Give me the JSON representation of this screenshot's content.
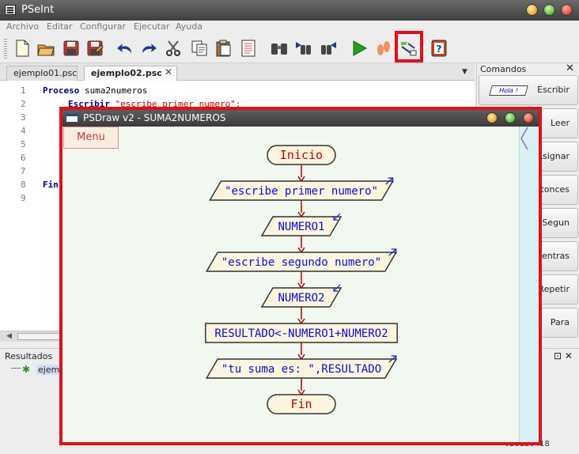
{
  "app": {
    "title": "PSeInt",
    "menu": [
      "Archivo",
      "Editar",
      "Configurar",
      "Ejecutar",
      "Ayuda"
    ],
    "toolbar_icons": [
      "new-file-icon",
      "open-folder-icon",
      "save-icon",
      "save-as-icon",
      "undo-icon",
      "redo-icon",
      "cut-icon",
      "copy-icon",
      "paste-icon",
      "edit-list-icon",
      "find-icon",
      "find-previous-icon",
      "find-next-icon",
      "run-icon",
      "step-by-step-icon",
      "draw-flowchart-icon",
      "help-icon"
    ]
  },
  "tabs": [
    {
      "label": "ejemplo01.psc",
      "active": false
    },
    {
      "label": "ejemplo02.psc",
      "active": true
    }
  ],
  "editor": {
    "lines": [
      {
        "n": "1",
        "kw": "Proceso",
        "rest": " suma2numeros"
      },
      {
        "n": "2",
        "kw": "Escribir",
        "rest": " \"escribe primer numero\";"
      },
      {
        "n": "3",
        "kw": "",
        "rest": ""
      },
      {
        "n": "4",
        "kw": "",
        "rest": ""
      },
      {
        "n": "5",
        "kw": "",
        "rest": ""
      },
      {
        "n": "6",
        "kw": "",
        "rest": ""
      },
      {
        "n": "7",
        "kw": "",
        "rest": ""
      },
      {
        "n": "8",
        "kw": "Fin",
        "rest": ""
      },
      {
        "n": "9",
        "kw": "",
        "rest": ""
      }
    ]
  },
  "comandos": {
    "title": "Comandos",
    "items": [
      "Escribir",
      "Leer",
      "Asignar",
      "Si-Entonces",
      "Segun",
      "Mientras",
      "Repetir",
      "Para"
    ],
    "hola_label": "Hola !"
  },
  "resultados": {
    "title": "Resultados",
    "item": "ejemplo02"
  },
  "version": "v20120418",
  "psdraw": {
    "title": "PSDraw v2 - SUMA2NUMEROS",
    "menu_label": "Menu",
    "flowchart": {
      "start": "Inicio",
      "steps": [
        {
          "type": "write",
          "text": "\"escribe primer numero\""
        },
        {
          "type": "read",
          "text": "NUMERO1"
        },
        {
          "type": "write",
          "text": "\"escribe segundo numero\""
        },
        {
          "type": "read",
          "text": "NUMERO2"
        },
        {
          "type": "assign",
          "text": "RESULTADO<-NUMERO1+NUMERO2"
        },
        {
          "type": "write",
          "text": "\"tu suma es: \",RESULTADO"
        }
      ],
      "end": "Fin"
    }
  },
  "colors": {
    "highlight": "#e0101a",
    "flow_text": "#0b0bd0",
    "flow_arrow": "#b00000",
    "terminal_text": "#c00000"
  }
}
